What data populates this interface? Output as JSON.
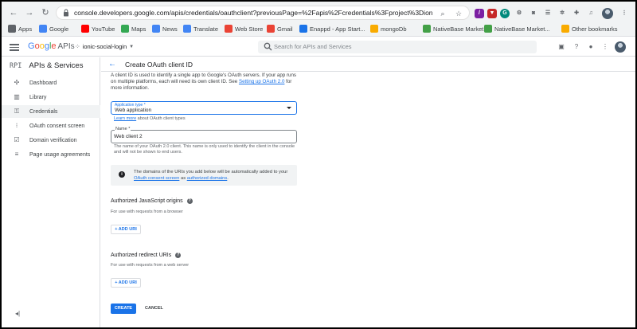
{
  "browser": {
    "url": "console.developers.google.com/apis/credentials/oauthclient?previousPage=%2Fapis%2Fcredentials%3Fproject%3Dionic-socia...",
    "bookmarks": [
      {
        "label": "Apps",
        "icon": "apps-grid-icon",
        "color": "#5f6368"
      },
      {
        "label": "Google",
        "icon": "google-icon",
        "color": "#4285f4"
      },
      {
        "label": "YouTube",
        "icon": "youtube-icon",
        "color": "#ff0000"
      },
      {
        "label": "Maps",
        "icon": "maps-icon",
        "color": "#34a853"
      },
      {
        "label": "News",
        "icon": "news-icon",
        "color": "#4285f4"
      },
      {
        "label": "Translate",
        "icon": "translate-icon",
        "color": "#4285f4"
      },
      {
        "label": "Web Store",
        "icon": "webstore-icon",
        "color": "#ea4335"
      },
      {
        "label": "Gmail",
        "icon": "gmail-icon",
        "color": "#ea4335"
      },
      {
        "label": "Enappd - App Start...",
        "icon": "enappd-icon",
        "color": "#1a73e8"
      },
      {
        "label": "mongoDb",
        "icon": "folder-icon",
        "color": "#f9ab00"
      },
      {
        "label": "NativeBase Market...",
        "icon": "nativebase-icon",
        "color": "#43a047"
      },
      {
        "label": "NativeBase Market...",
        "icon": "nativebase-icon",
        "color": "#43a047"
      }
    ],
    "other_bookmarks": "Other bookmarks"
  },
  "header": {
    "logo_google": "Google",
    "logo_apis": "APIs",
    "project": "ionic-social-login",
    "search_placeholder": "Search for APIs and Services"
  },
  "sidebar": {
    "badge": "RPI",
    "title": "APIs & Services",
    "items": [
      {
        "label": "Dashboard",
        "icon": "dashboard-icon",
        "glyph": "✣"
      },
      {
        "label": "Library",
        "icon": "library-icon",
        "glyph": "▥"
      },
      {
        "label": "Credentials",
        "icon": "key-icon",
        "glyph": "⚿",
        "active": true
      },
      {
        "label": "OAuth consent screen",
        "icon": "consent-icon",
        "glyph": "⁝"
      },
      {
        "label": "Domain verification",
        "icon": "verification-icon",
        "glyph": "☑"
      },
      {
        "label": "Page usage agreements",
        "icon": "agreements-icon",
        "glyph": "≡"
      }
    ],
    "collapse_glyph": "◂|"
  },
  "main": {
    "title": "Create OAuth client ID",
    "intro_pre": "A client ID is used to identify a single app to Google's OAuth servers. If your app runs on multiple platforms, each will need its own client ID. See ",
    "intro_link": "Setting up OAuth 2.0",
    "intro_post": " for more information.",
    "app_type_label": "Application type *",
    "app_type_value": "Web application",
    "learn_more_link": "Learn more",
    "learn_more_rest": " about OAuth client types",
    "name_label": "Name *",
    "name_value": "Web client 2",
    "name_help": "The name of your OAuth 2.0 client. This name is only used to identify the client in the console and will not be shown to end users.",
    "notice_pre": "The domains of the URIs you add below will be automatically added to your ",
    "notice_link1": "OAuth consent screen",
    "notice_mid": " as ",
    "notice_link2": "authorized domains",
    "notice_post": ".",
    "js_origins_title": "Authorized JavaScript origins",
    "js_origins_sub": "For use with requests from a browser",
    "redirect_title": "Authorized redirect URIs",
    "redirect_sub": "For use with requests from a web server",
    "add_uri": "+ ADD URI",
    "create": "CREATE",
    "cancel": "CANCEL"
  }
}
